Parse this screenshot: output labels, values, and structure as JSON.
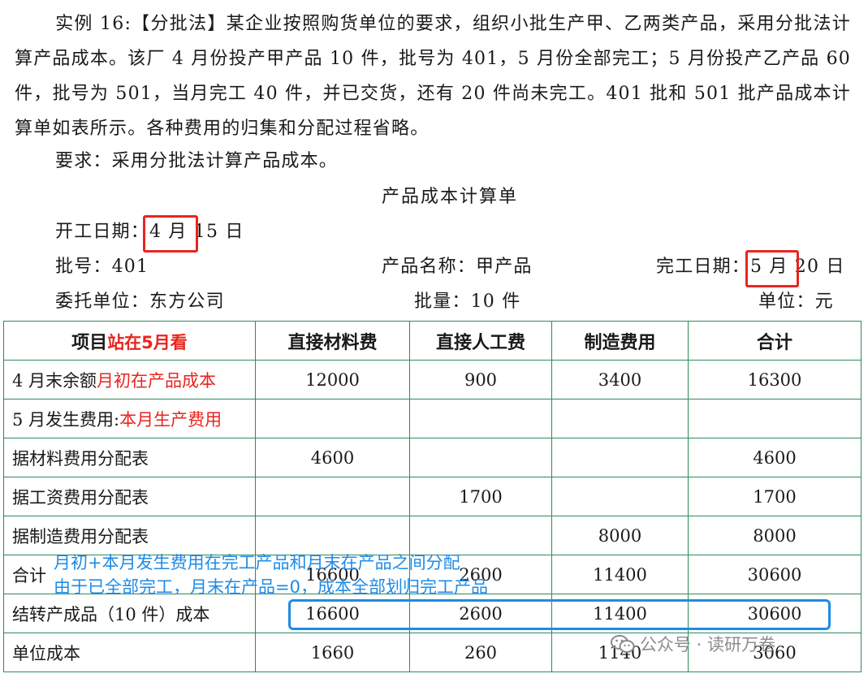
{
  "problem": {
    "line1": "实例 16:【分批法】某企业按照购货单位的要求，组织小批生产甲、乙两类产品，采用分批法计算产品成本。该厂 4 月份投产甲产品 10 件，批号为 401，5 月份全部完工；5 月份投产乙产品 60 件，批号为 501，当月完工 40 件，并已交货，还有 20 件尚未完工。401 批和 501 批产品成本计算单如表所示。各种费用的归集和分配过程省略。",
    "requirement": "要求：采用分批法计算产品成本。"
  },
  "sheet": {
    "title": "产品成本计算单",
    "start_date": "开工日期：4 月 15 日",
    "batch_no": "批号：401",
    "product_name": "产品名称：甲产品",
    "finish_date": "完工日期：5 月 20 日",
    "client": "委托单位：东方公司",
    "quantity": "批量：10 件",
    "unit": "单位：元"
  },
  "table": {
    "headers": [
      "项目",
      "直接材料费",
      "直接人工费",
      "制造费用",
      "合计"
    ],
    "header_note": "站在5月看",
    "rows": [
      {
        "label": "4 月末余额",
        "note": "月初在产品成本",
        "cells": [
          "12000",
          "900",
          "3400",
          "16300"
        ]
      },
      {
        "label": "5 月发生费用:",
        "note": "本月生产费用",
        "cells": [
          "",
          "",
          "",
          ""
        ]
      },
      {
        "label": "据材料费用分配表",
        "note": "",
        "cells": [
          "4600",
          "",
          "",
          "4600"
        ]
      },
      {
        "label": "据工资费用分配表",
        "note": "",
        "cells": [
          "",
          "1700",
          "",
          "1700"
        ]
      },
      {
        "label": "据制造费用分配表",
        "note": "",
        "cells": [
          "",
          "",
          "8000",
          "8000"
        ]
      },
      {
        "label": "合计",
        "note": "",
        "cells": [
          "16600",
          "2600",
          "11400",
          "30600"
        ]
      },
      {
        "label": "结转产成品（10 件）成本",
        "note": "",
        "cells": [
          "16600",
          "2600",
          "11400",
          "30600"
        ]
      },
      {
        "label": "单位成本",
        "note": "",
        "cells": [
          "1660",
          "260",
          "1140",
          "3060"
        ]
      }
    ]
  },
  "annotations": {
    "blue_line1": "月初+本月发生费用在完工产品和月末在产品之间分配",
    "blue_line2": "由于已全部完工，月末在产品=0，成本全部划归完工产品"
  },
  "watermark": {
    "text": "公众号 · 读研万卷",
    "icon": "wechat-icon"
  },
  "colors": {
    "annotation_red": "#e8251f",
    "annotation_blue": "#1e8be6",
    "table_border": "#2e8b57"
  }
}
